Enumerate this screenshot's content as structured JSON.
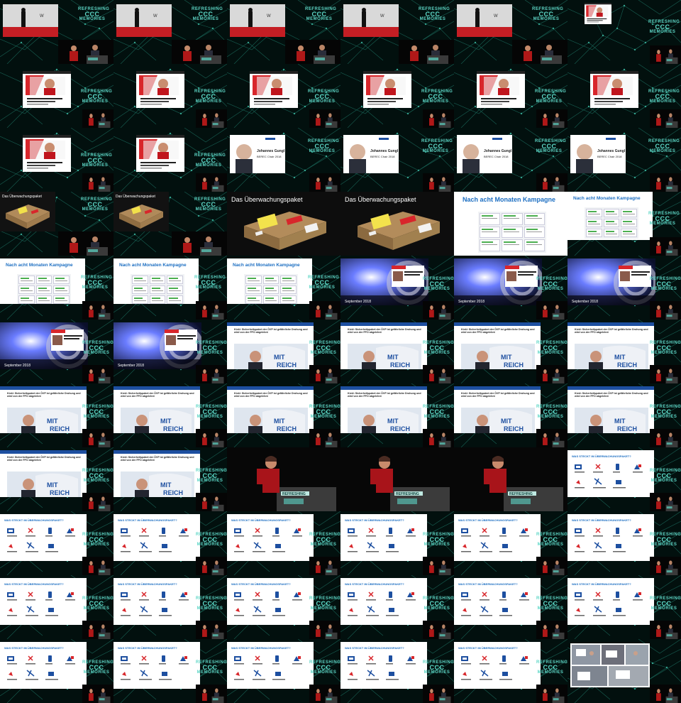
{
  "colors": {
    "background": "#000000",
    "network": "#0f3b34",
    "network_line": "#1f7a6a",
    "accent_teal": "#5ed6c6",
    "slide_blue": "#1d6fc2",
    "slide_red": "#d8262b"
  },
  "logo_text": {
    "line1": "REFRESHING",
    "line2": "CCC",
    "line3": "MEMORIES"
  },
  "slides": {
    "paket_title": "Das Überwachungspaket",
    "paket_title_large": "Das Überwachungspaket",
    "kampagne_title": "Nach acht Monaten Kampagne",
    "september_caption": "September 2018",
    "article_headline": "Kickl: Sicherheitspaket der ÖVP ist gefährliche Drohung und wird von der FPÖ abgelehnt",
    "gungl_name": "Johannes Gungl",
    "gungl_role": "BEREC Chair 2018",
    "ueberwachung_title": "WAS STECKT IM ÜBERWACHUNGSPAKET?"
  },
  "tiles": [
    {
      "row": 0,
      "col": 0,
      "kind": "stage"
    },
    {
      "row": 0,
      "col": 1,
      "kind": "stage"
    },
    {
      "row": 0,
      "col": 2,
      "kind": "stage"
    },
    {
      "row": 0,
      "col": 3,
      "kind": "stage"
    },
    {
      "row": 0,
      "col": 4,
      "kind": "stage"
    },
    {
      "row": 0,
      "col": 5,
      "kind": "portrait-small"
    },
    {
      "row": 1,
      "col": 0,
      "kind": "portrait"
    },
    {
      "row": 1,
      "col": 1,
      "kind": "portrait"
    },
    {
      "row": 1,
      "col": 2,
      "kind": "portrait"
    },
    {
      "row": 1,
      "col": 3,
      "kind": "portrait"
    },
    {
      "row": 1,
      "col": 4,
      "kind": "portrait"
    },
    {
      "row": 1,
      "col": 5,
      "kind": "portrait"
    },
    {
      "row": 2,
      "col": 0,
      "kind": "portrait"
    },
    {
      "row": 2,
      "col": 1,
      "kind": "portrait"
    },
    {
      "row": 2,
      "col": 2,
      "kind": "gungl"
    },
    {
      "row": 2,
      "col": 3,
      "kind": "gungl"
    },
    {
      "row": 2,
      "col": 4,
      "kind": "gungl"
    },
    {
      "row": 2,
      "col": 5,
      "kind": "gungl"
    },
    {
      "row": 3,
      "col": 0,
      "kind": "paket-small"
    },
    {
      "row": 3,
      "col": 1,
      "kind": "paket-small"
    },
    {
      "row": 3,
      "col": 2,
      "kind": "paket-large"
    },
    {
      "row": 3,
      "col": 3,
      "kind": "paket-large"
    },
    {
      "row": 3,
      "col": 4,
      "kind": "kampagne-large"
    },
    {
      "row": 3,
      "col": 5,
      "kind": "kampagne-mid"
    },
    {
      "row": 4,
      "col": 0,
      "kind": "kampagne"
    },
    {
      "row": 4,
      "col": 1,
      "kind": "kampagne"
    },
    {
      "row": 4,
      "col": 2,
      "kind": "kampagne"
    },
    {
      "row": 4,
      "col": 3,
      "kind": "september"
    },
    {
      "row": 4,
      "col": 4,
      "kind": "september"
    },
    {
      "row": 4,
      "col": 5,
      "kind": "september"
    },
    {
      "row": 5,
      "col": 0,
      "kind": "september"
    },
    {
      "row": 5,
      "col": 1,
      "kind": "september"
    },
    {
      "row": 5,
      "col": 2,
      "kind": "article"
    },
    {
      "row": 5,
      "col": 3,
      "kind": "article"
    },
    {
      "row": 5,
      "col": 4,
      "kind": "article"
    },
    {
      "row": 5,
      "col": 5,
      "kind": "article"
    },
    {
      "row": 6,
      "col": 0,
      "kind": "article"
    },
    {
      "row": 6,
      "col": 1,
      "kind": "article"
    },
    {
      "row": 6,
      "col": 2,
      "kind": "article"
    },
    {
      "row": 6,
      "col": 3,
      "kind": "article"
    },
    {
      "row": 6,
      "col": 4,
      "kind": "article"
    },
    {
      "row": 6,
      "col": 5,
      "kind": "article"
    },
    {
      "row": 7,
      "col": 0,
      "kind": "article"
    },
    {
      "row": 7,
      "col": 1,
      "kind": "article"
    },
    {
      "row": 7,
      "col": 2,
      "kind": "speaker-close"
    },
    {
      "row": 7,
      "col": 3,
      "kind": "speaker-close"
    },
    {
      "row": 7,
      "col": 4,
      "kind": "speaker-close"
    },
    {
      "row": 7,
      "col": 5,
      "kind": "ueberwachung"
    },
    {
      "row": 8,
      "col": 0,
      "kind": "ueberwachung"
    },
    {
      "row": 8,
      "col": 1,
      "kind": "ueberwachung"
    },
    {
      "row": 8,
      "col": 2,
      "kind": "ueberwachung"
    },
    {
      "row": 8,
      "col": 3,
      "kind": "ueberwachung"
    },
    {
      "row": 8,
      "col": 4,
      "kind": "ueberwachung"
    },
    {
      "row": 8,
      "col": 5,
      "kind": "ueberwachung"
    },
    {
      "row": 9,
      "col": 0,
      "kind": "ueberwachung"
    },
    {
      "row": 9,
      "col": 1,
      "kind": "ueberwachung"
    },
    {
      "row": 9,
      "col": 2,
      "kind": "ueberwachung"
    },
    {
      "row": 9,
      "col": 3,
      "kind": "ueberwachung"
    },
    {
      "row": 9,
      "col": 4,
      "kind": "ueberwachung"
    },
    {
      "row": 9,
      "col": 5,
      "kind": "ueberwachung"
    },
    {
      "row": 10,
      "col": 0,
      "kind": "ueberwachung"
    },
    {
      "row": 10,
      "col": 1,
      "kind": "ueberwachung"
    },
    {
      "row": 10,
      "col": 2,
      "kind": "ueberwachung"
    },
    {
      "row": 10,
      "col": 3,
      "kind": "ueberwachung"
    },
    {
      "row": 10,
      "col": 4,
      "kind": "ueberwachung"
    },
    {
      "row": 10,
      "col": 5,
      "kind": "protest"
    }
  ]
}
